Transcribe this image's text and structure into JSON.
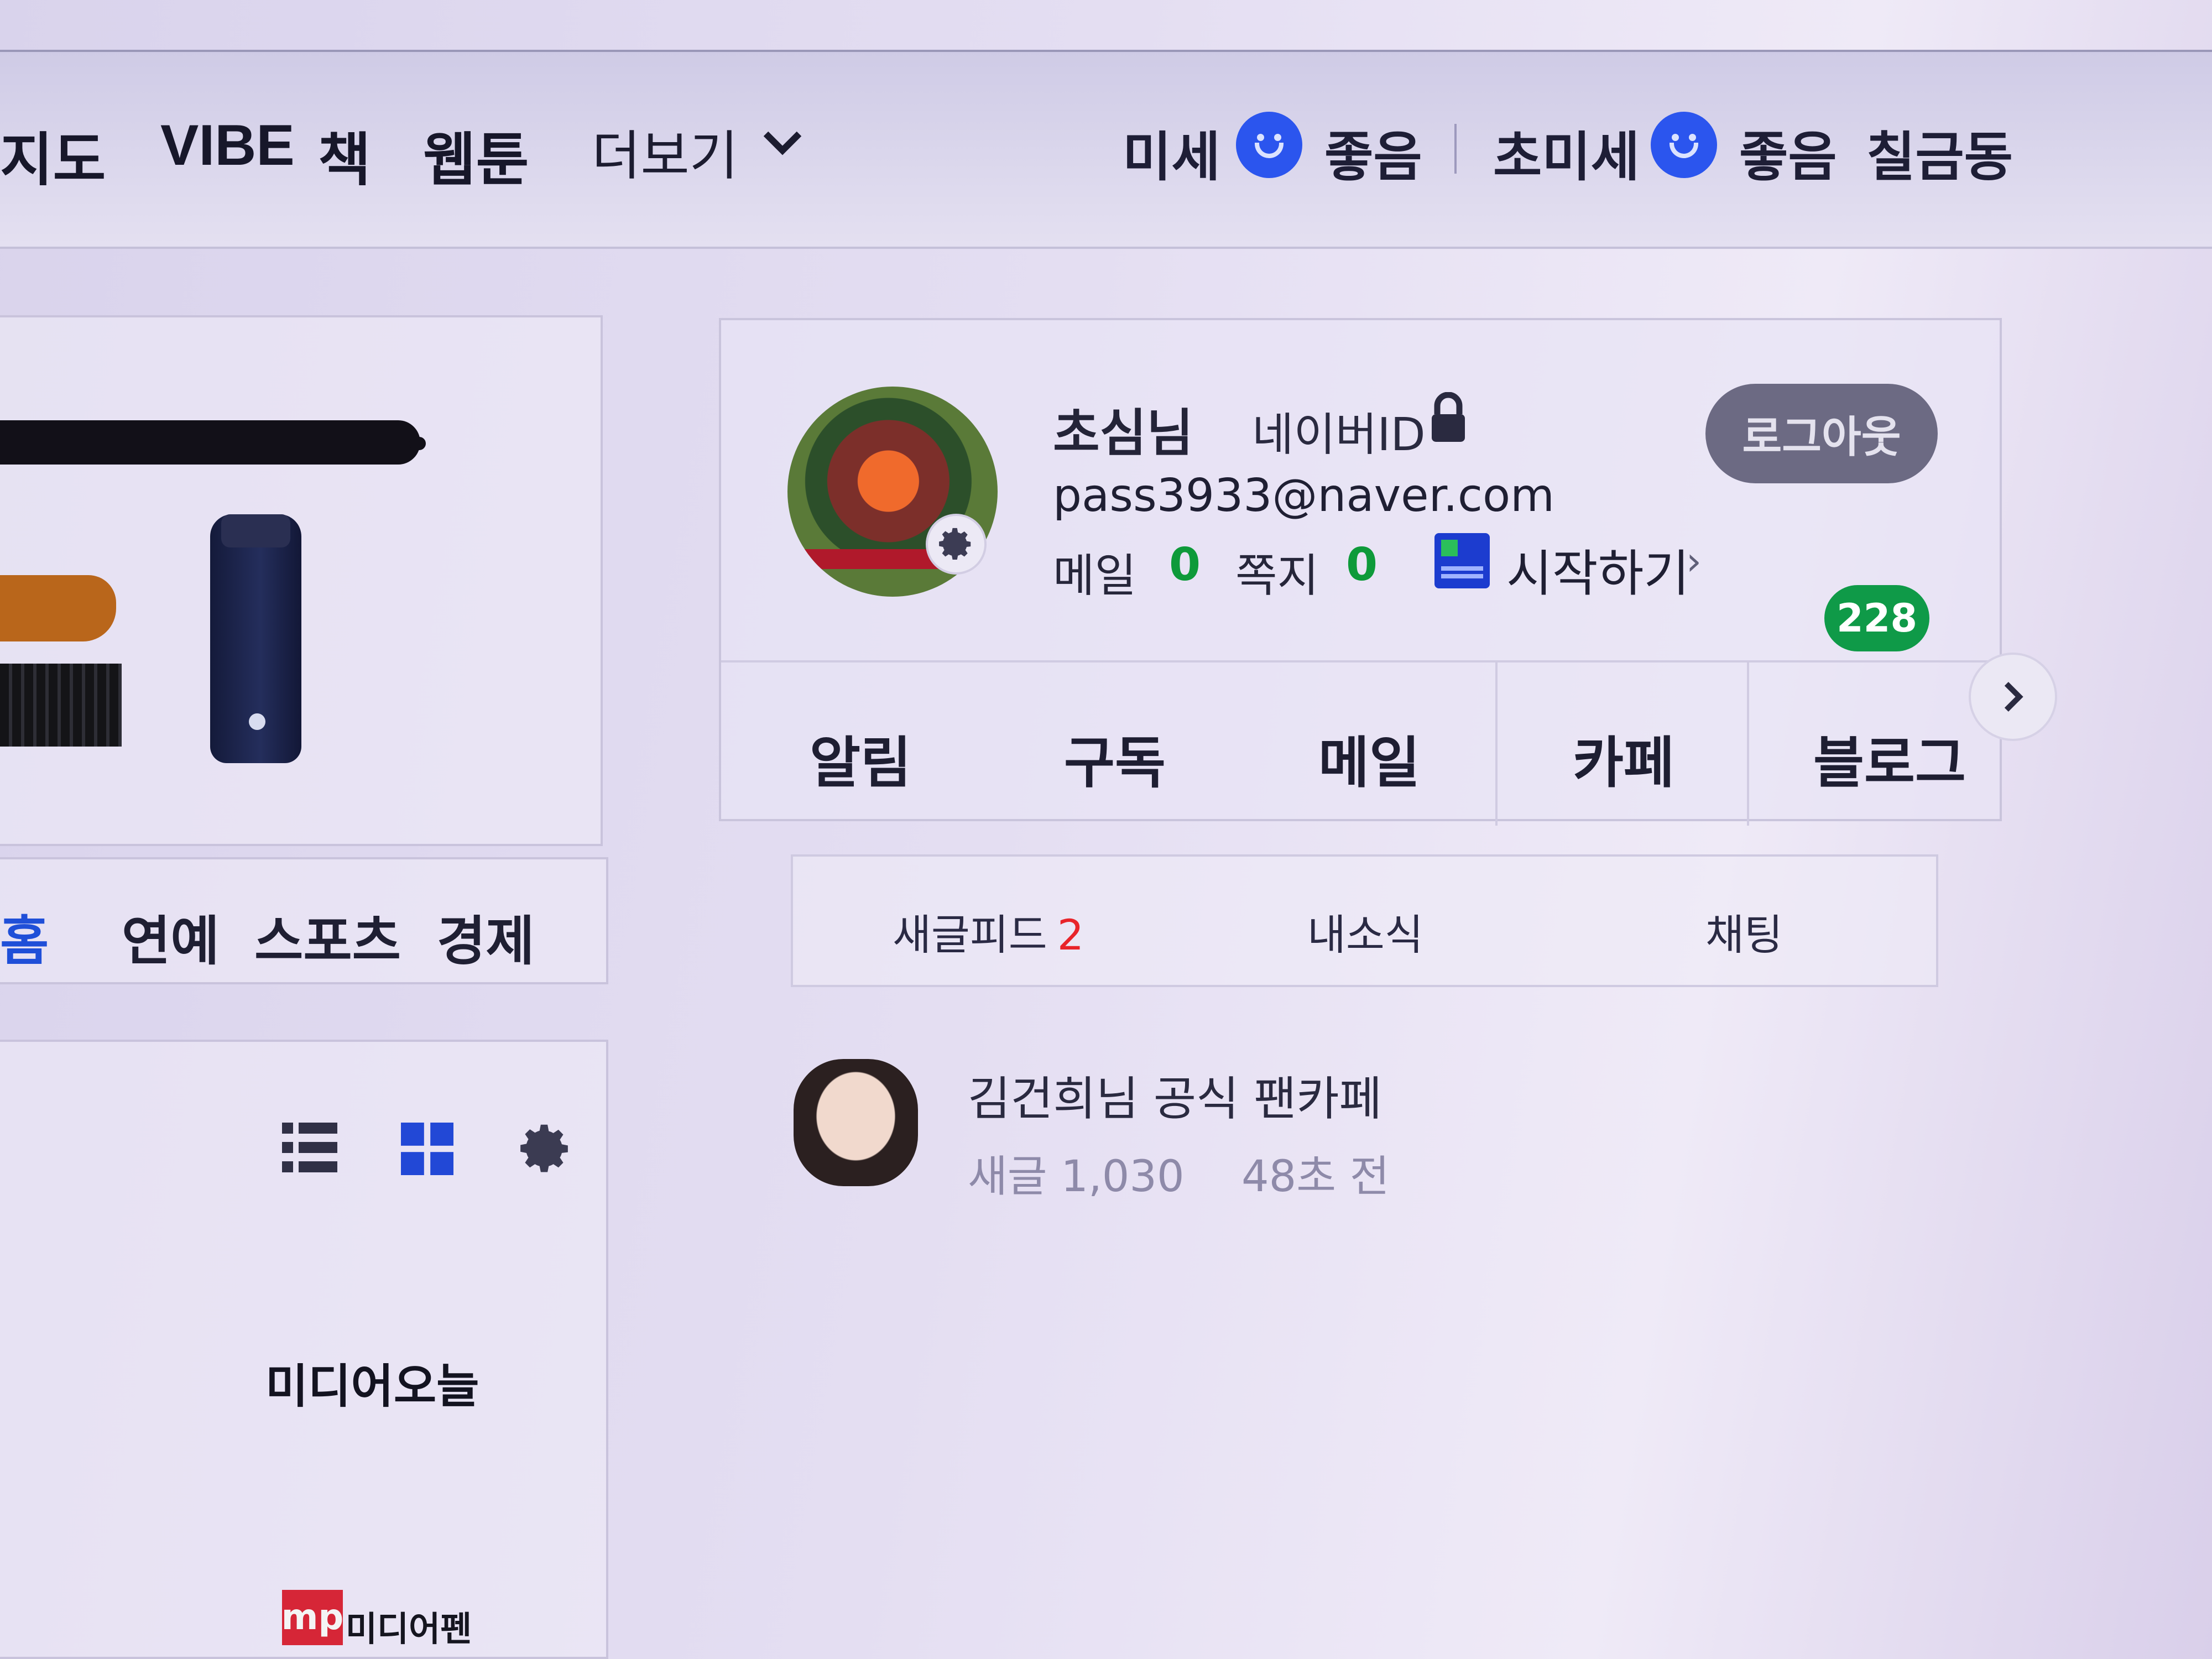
{
  "header": {
    "nav": [
      "지도",
      "VIBE",
      "책",
      "웹툰"
    ],
    "more_label": "더보기",
    "air": {
      "fine_dust_label": "미세",
      "fine_dust_status": "좋음",
      "ultrafine_dust_label": "초미세",
      "ultrafine_dust_status": "좋음",
      "location": "칠금동"
    }
  },
  "left": {
    "news_tabs": [
      "홈",
      "연예",
      "스포츠",
      "경제"
    ],
    "news_active_tab": "홈",
    "press_logos": [
      "미디어오늘",
      "미디어펜"
    ],
    "press_logo_mp_badge": "mp"
  },
  "account": {
    "nickname": "초심님",
    "id_type": "네이버ID",
    "email": "pass3933@naver.com",
    "mail_label": "메일",
    "mail_count": "0",
    "note_label": "쪽지",
    "note_count": "0",
    "start_label": "시작하기",
    "logout_label": "로그아웃",
    "services": [
      "알림",
      "구독",
      "메일",
      "카페",
      "블로그"
    ],
    "blog_badge": "228",
    "sub_tabs": {
      "feed_label": "새글피드",
      "feed_count": "2",
      "my_news_label": "내소식",
      "chat_label": "채팅"
    },
    "feed_item": {
      "title": "김건희님 공식 팬카페",
      "new_posts": "새글 1,030",
      "time": "48초 전"
    }
  },
  "colors": {
    "accent_blue": "#2b55ee",
    "count_green": "#0e9a3a",
    "badge_green": "#0f9a48",
    "count_red": "#e8242a"
  },
  "icons": [
    "smile-icon",
    "chevron-down-icon",
    "gear-icon",
    "lock-icon",
    "grid-apps-icon",
    "chevron-right-icon",
    "list-view-icon",
    "tile-view-icon",
    "settings-icon"
  ]
}
